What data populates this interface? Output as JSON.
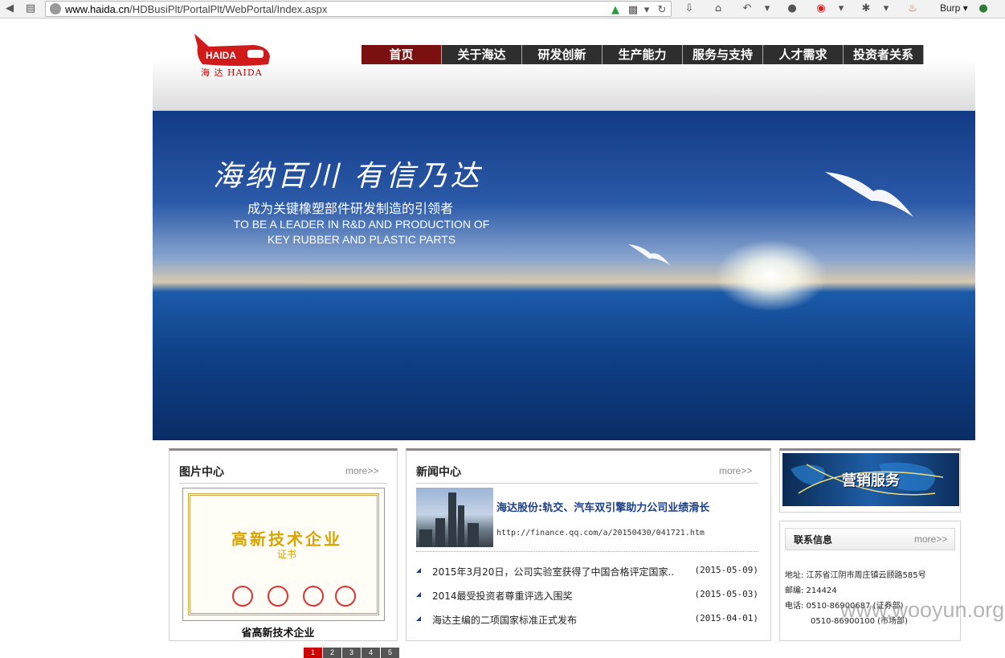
{
  "browser": {
    "url_domain": "www.haida.cn",
    "url_path": "/HDBusiPlt/PortalPlt/WebPortal/Index.aspx",
    "burp_label": "Burp"
  },
  "site": {
    "logo_text": "HAIDA",
    "logo_sub": "海 达 HAIDA",
    "nav": [
      "首页",
      "关于海达",
      "研发创新",
      "生产能力",
      "服务与支持",
      "人才需求",
      "投资者关系"
    ],
    "active_nav_index": 0
  },
  "banner": {
    "slogan": "海纳百川  有信乃达",
    "tagline_cn": "成为关键橡塑部件研发制造的引领者",
    "tagline_en": "TO BE A LEADER IN R&D AND PRODUCTION OF KEY RUBBER AND PLASTIC PARTS"
  },
  "gallery": {
    "title": "图片中心",
    "more": "more>>",
    "cert_title": "高新技术企业",
    "cert_sub": "证书",
    "pages": [
      "1",
      "2",
      "3",
      "4",
      "5"
    ],
    "active_page": 0,
    "caption": "省高新技术企业"
  },
  "news": {
    "title": "新闻中心",
    "more": "more>>",
    "headline": "海达股份:轨交、汽车双引擎助力公司业绩滑长",
    "headline_url": "http://finance.qq.com/a/20150430/041721.htm",
    "items": [
      {
        "title": "2015年3月20日，公司实验室获得了中国合格评定国家..",
        "date": "(2015-05-09)"
      },
      {
        "title": "2014最受投资者尊重评选入围奖",
        "date": "(2015-05-03)"
      },
      {
        "title": "海达主编的二项国家标准正式发布",
        "date": "(2015-04-01)"
      }
    ]
  },
  "sidebar": {
    "sales_label": "营销服务",
    "contact_title": "联系信息",
    "more": "more>>",
    "address": "地址: 江苏省江阴市周庄镇云顾路585号",
    "postcode": "邮编: 214424",
    "phone1": "电话: 0510-86900687 (证券部)",
    "phone2": "0510-86900100 (市场部)"
  },
  "watermark": "www.wooyun.org",
  "colors": {
    "nav_active": "#7a1010",
    "nav_bg": "#2e2e2e",
    "link_blue": "#1a3f87",
    "brand_red": "#d11a1a"
  }
}
